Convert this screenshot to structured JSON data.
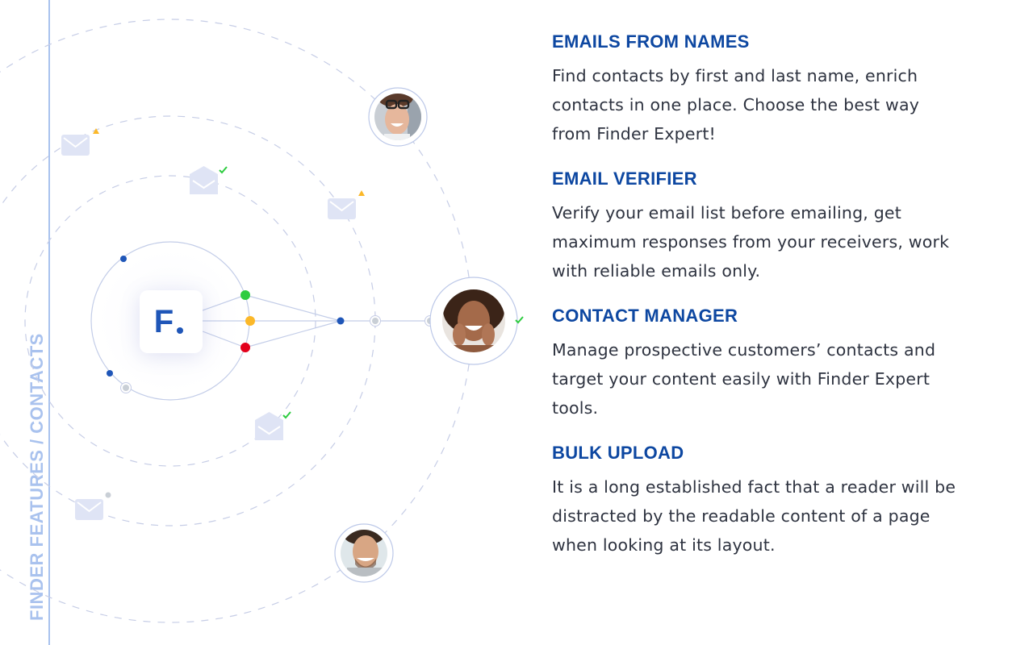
{
  "sidebar": {
    "label": "FINDER FEATURES / CONTACTS"
  },
  "diagram": {
    "logo": {
      "letter": "F",
      "brand_color": "#1f56b8"
    },
    "node_colors": {
      "green": "#2ecc40",
      "yellow": "#fbb829",
      "red": "#e3001b",
      "blue": "#1f56b8",
      "gray": "#c9cfd6"
    },
    "envelopes": [
      {
        "state": "warning-icon",
        "badge_color": "#fbb829"
      },
      {
        "state": "check-icon",
        "badge_color": "#2ecc40"
      },
      {
        "state": "warning-icon",
        "badge_color": "#fbb829"
      },
      {
        "state": "check-icon",
        "badge_color": "#2ecc40"
      },
      {
        "state": "pending-dot-icon",
        "badge_color": "#c9cfd6"
      }
    ],
    "avatars": [
      {
        "name": "avatar-woman-glasses"
      },
      {
        "name": "avatar-woman-smiling",
        "verified": true
      },
      {
        "name": "avatar-man-laughing"
      }
    ]
  },
  "features": [
    {
      "title": "EMAILS FROM NAMES",
      "description": "Find contacts by first and last name, enrich contacts in one place. Choose the best way from Finder Expert!"
    },
    {
      "title": "EMAIL VERIFIER",
      "description": "Verify your email list before emailing, get maximum responses from your receivers, work with reliable emails only."
    },
    {
      "title": "CONTACT MANAGER",
      "description": "Manage prospective customers’ contacts and target your content easily with Finder Expert tools."
    },
    {
      "title": "BULK UPLOAD",
      "description": "It is a long established fact that a reader will be distracted by the readable content of a page when looking at its layout."
    }
  ],
  "colors": {
    "heading": "#0d47a1",
    "body_text": "#2e3340",
    "accent_line": "#a9c2ee"
  }
}
